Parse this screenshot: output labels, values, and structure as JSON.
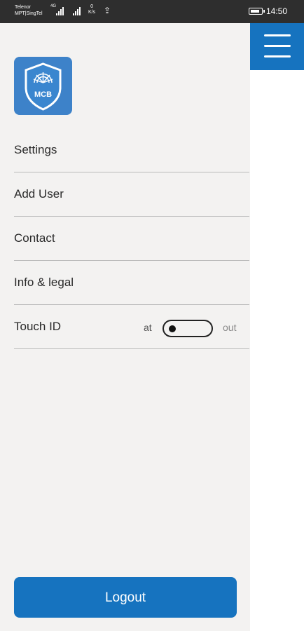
{
  "status_bar": {
    "carrier_line1": "Telenor",
    "carrier_line2": "MPT|SingTel",
    "network_type": "4G",
    "speed_value": "0",
    "speed_unit": "K/s",
    "battery_level": 0.85,
    "time": "14:50"
  },
  "drawer": {
    "logo_text": "MCB",
    "menu_items": [
      {
        "label": "Settings"
      },
      {
        "label": "Add User"
      },
      {
        "label": "Contact"
      },
      {
        "label": "Info & legal"
      }
    ],
    "touch_id": {
      "label": "Touch ID",
      "left_label": "at",
      "right_label": "out",
      "state": "at"
    },
    "logout_label": "Logout"
  },
  "colors": {
    "accent": "#1673bf",
    "drawer_bg": "#f3f2f1",
    "status_bar": "#2e2e2e",
    "logo_bg": "#3d82c9"
  }
}
